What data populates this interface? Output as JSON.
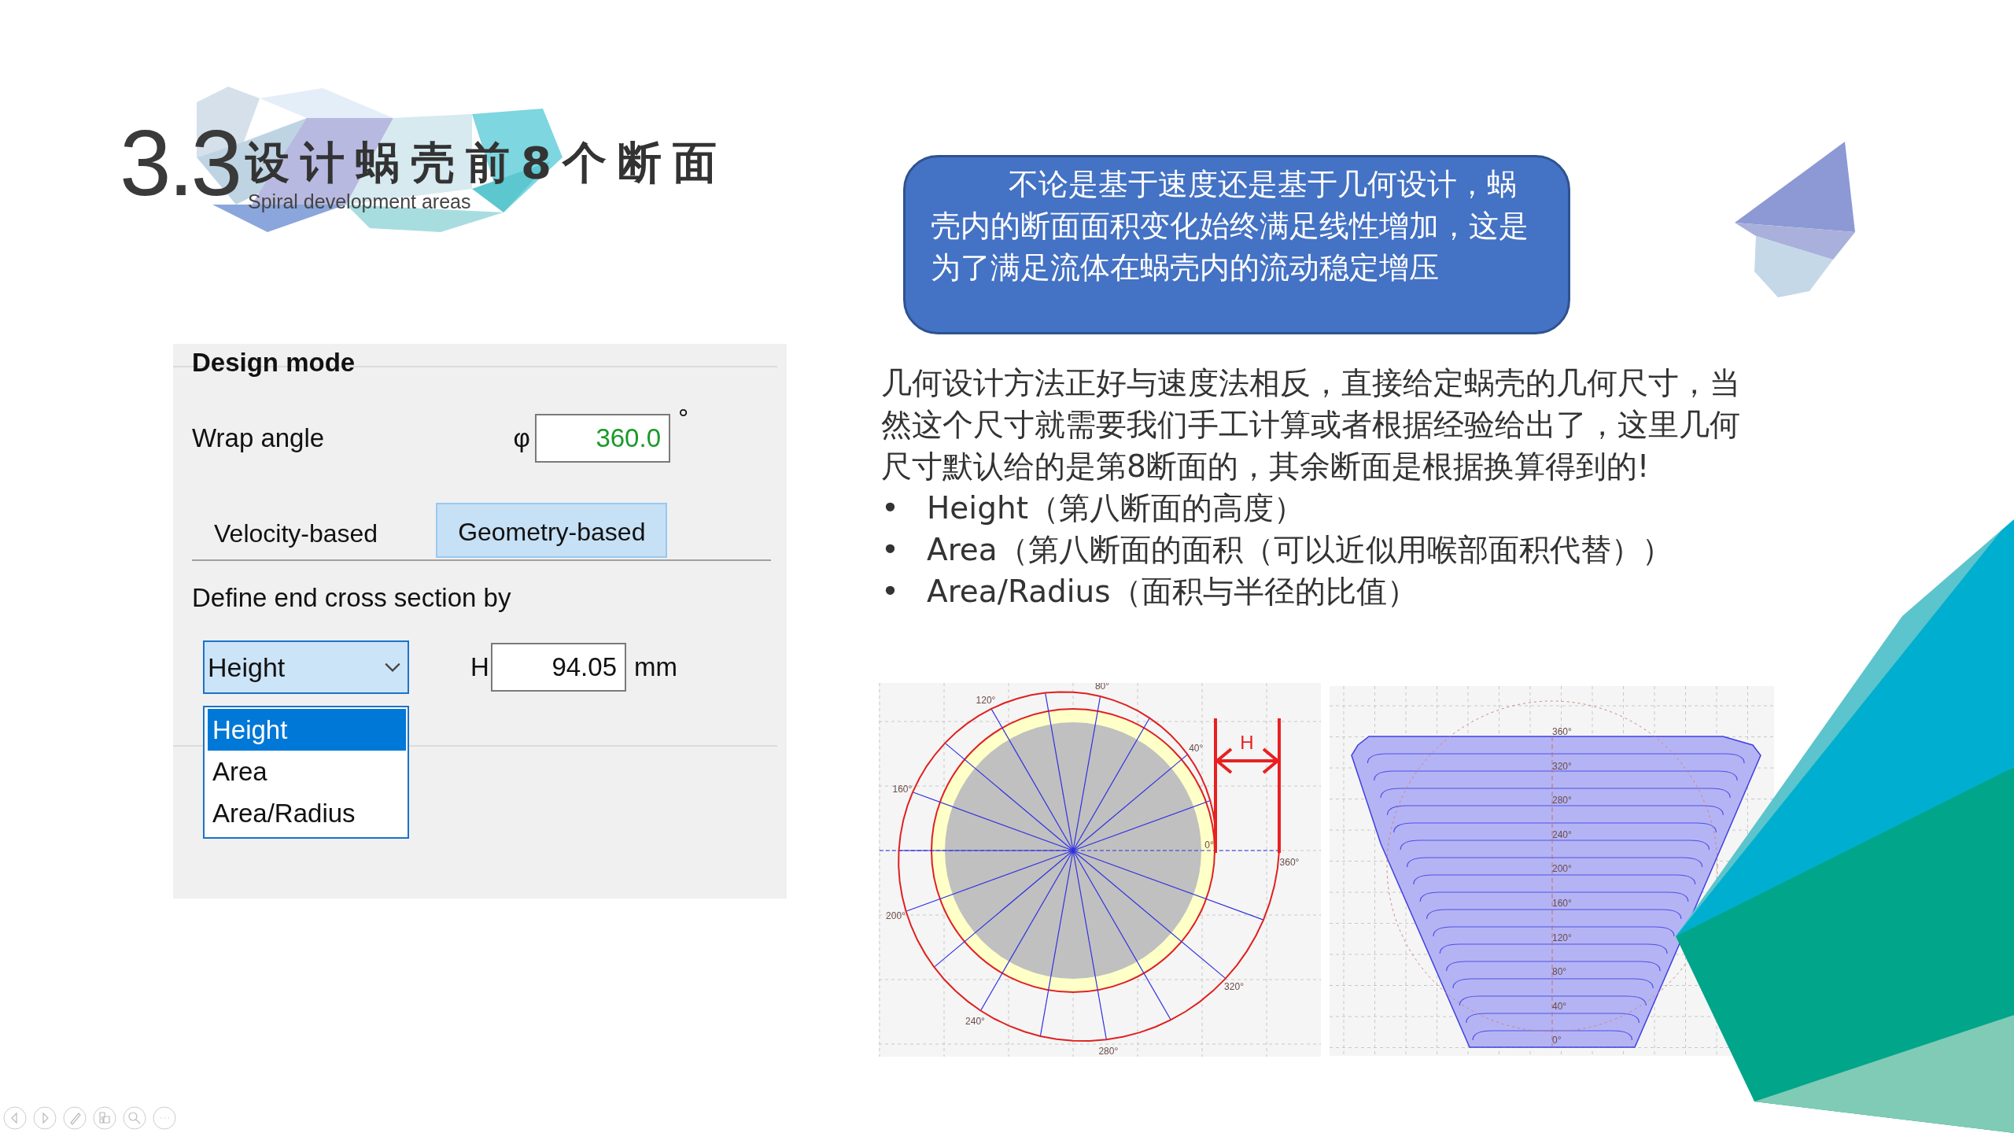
{
  "slide": {
    "title": {
      "number": "3.3",
      "text": "设计蜗壳前8个断面",
      "subtitle": "Spiral development areas"
    },
    "dialog": {
      "group_title": "Design mode",
      "wrap_angle": {
        "label": "Wrap angle",
        "symbol": "φ",
        "value": "360.0",
        "unit": "°"
      },
      "tabs": [
        {
          "label": "Velocity-based",
          "selected": false
        },
        {
          "label": "Geometry-based",
          "selected": true
        }
      ],
      "define_label": "Define end cross section by",
      "dropdown": {
        "value": "Height",
        "expanded": true,
        "options": [
          {
            "label": "Height",
            "selected": true
          },
          {
            "label": "Area",
            "selected": false
          },
          {
            "label": "Area/Radius",
            "selected": false
          }
        ]
      },
      "height_field": {
        "symbol": "H",
        "value": "94.05",
        "unit": "mm"
      }
    },
    "callout": "不论是基于速度还是基于几何设计，蜗壳内的断面面积变化始终满足线性增加，这是为了满足流体在蜗壳内的流动稳定增压",
    "paragraph": "几何设计方法正好与速度法相反，直接给定蜗壳的几何尺寸，当然这个尺寸就需要我们手工计算或者根据经验给出了，这里几何尺寸默认给的是第8断面的，其余断面是根据换算得到的!",
    "bullets": [
      {
        "marker": "•",
        "text": "Height（第八断面的高度）"
      },
      {
        "marker": "•",
        "text": "Area（第八断面的面积（可以近似用喉部面积代替））"
      },
      {
        "marker": "•",
        "text": "Area/Radius（面积与半径的比值）"
      }
    ],
    "spiral_diagram": {
      "angle_labels": [
        "0°",
        "40°",
        "80°",
        "120°",
        "160°",
        "200°",
        "240°",
        "280°",
        "320°",
        "360°"
      ],
      "dimension_label": "H"
    },
    "development_diagram": {
      "angle_labels": [
        "360°",
        "320°",
        "280°",
        "240°",
        "200°",
        "160°",
        "120°",
        "80°",
        "40°",
        "0°"
      ]
    }
  }
}
